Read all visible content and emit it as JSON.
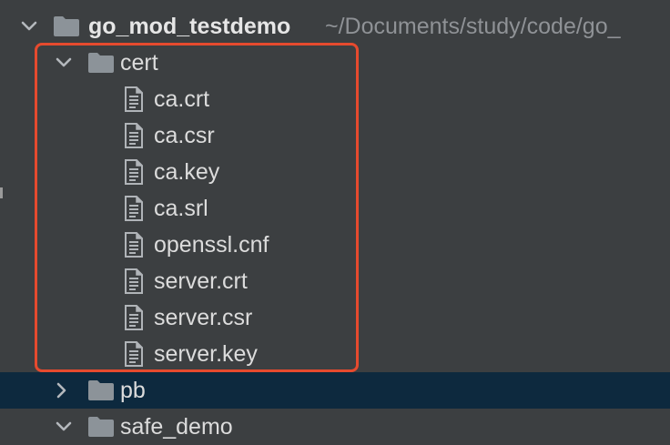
{
  "tree": {
    "root": {
      "label": "go_mod_testdemo",
      "path": "~/Documents/study/code/go_"
    },
    "cert": {
      "label": "cert",
      "files": [
        {
          "label": "ca.crt"
        },
        {
          "label": "ca.csr"
        },
        {
          "label": "ca.key"
        },
        {
          "label": "ca.srl"
        },
        {
          "label": "openssl.cnf"
        },
        {
          "label": "server.crt"
        },
        {
          "label": "server.csr"
        },
        {
          "label": "server.key"
        }
      ]
    },
    "pb": {
      "label": "pb"
    },
    "safe_demo": {
      "label": "safe_demo"
    }
  },
  "colors": {
    "background": "#3c3f41",
    "selected_row": "#0d293e",
    "highlight": "#e64a2e",
    "folder": "#8c9399",
    "text": "#dcdcdc",
    "path_text": "#8f9296"
  }
}
